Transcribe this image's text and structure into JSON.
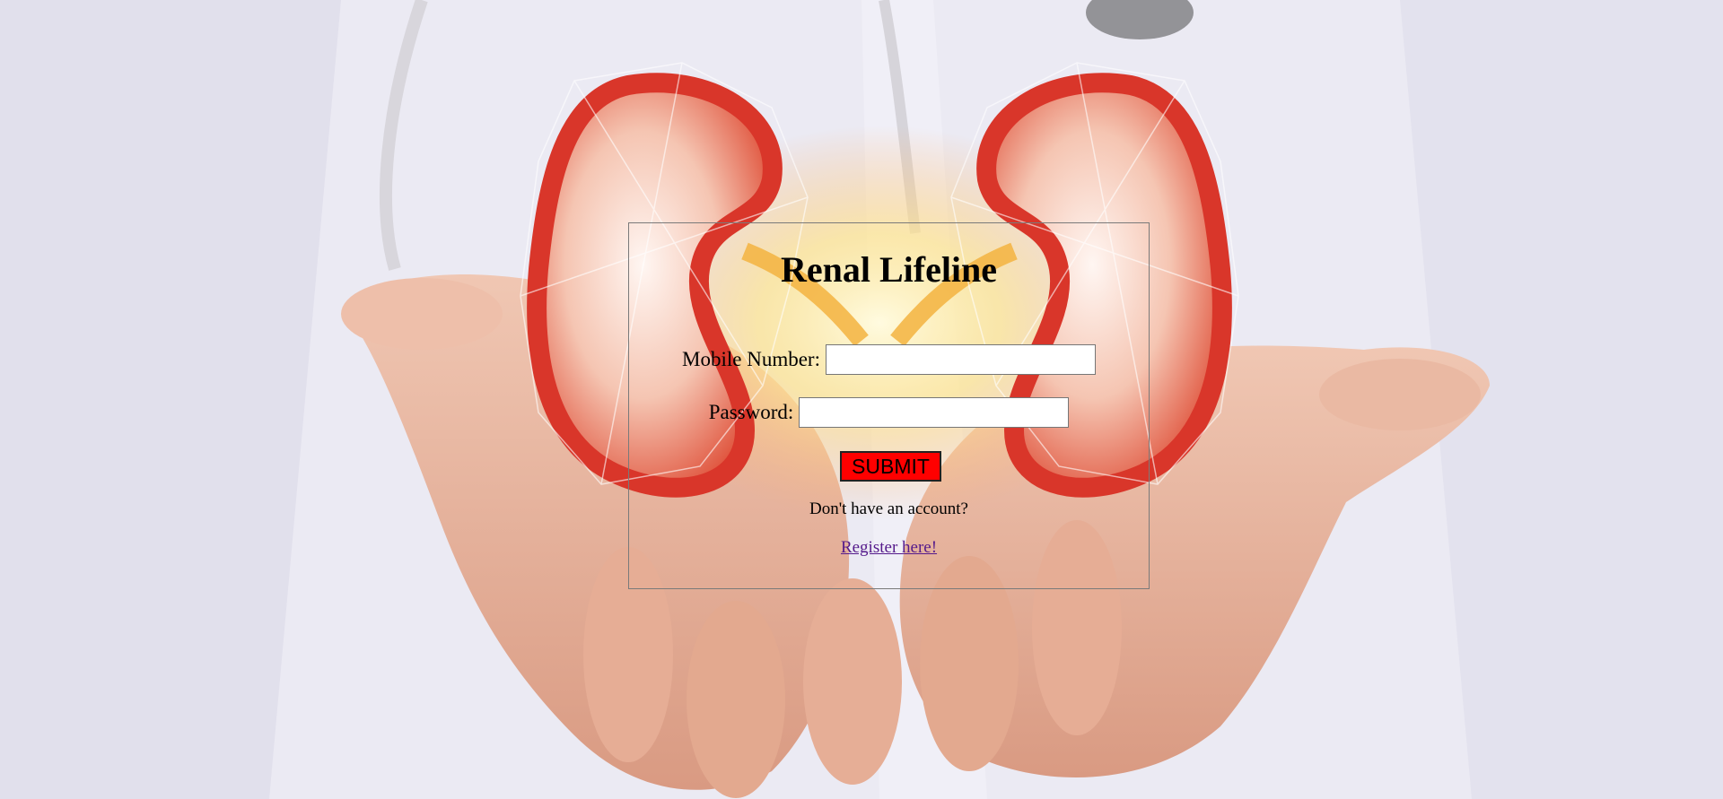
{
  "page": {
    "background_description_colors": {
      "coat": "#ecebf4",
      "skin": "#e8b39a",
      "kidney_outer": "#d9362a",
      "kidney_inner": "#f7d7c8",
      "glow": "#fff3b0"
    }
  },
  "login": {
    "title": "Renal Lifeline",
    "mobile_label": "Mobile Number:",
    "mobile_value": "",
    "password_label": "Password:",
    "password_value": "",
    "submit_label": "SUBMIT",
    "submit_color": "#ff0000",
    "no_account_text": "Don't have an account?",
    "register_link_text": "Register here!",
    "register_link_color": "#551a8b"
  }
}
